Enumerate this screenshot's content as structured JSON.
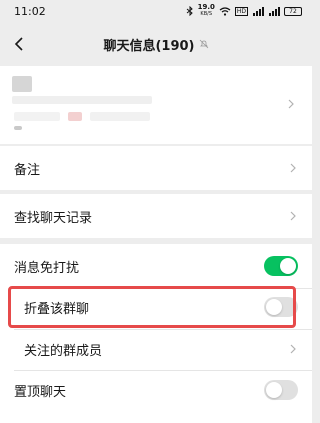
{
  "status_bar": {
    "time": "11:02",
    "speed": "19.0",
    "speed_unit": "KB/S",
    "battery": "72",
    "icons": [
      "bluetooth-icon",
      "wifi-icon",
      "hd-icon",
      "signal-icon",
      "signal-icon",
      "battery-icon"
    ]
  },
  "nav": {
    "title": "聊天信息(190)",
    "mute_icon": "bell-off-icon"
  },
  "rows": {
    "remark": "备注",
    "search_history": "查找聊天记录",
    "mute": "消息免打扰",
    "fold_group": "折叠该群聊",
    "followed_members": "关注的群成员",
    "pin_chat": "置顶聊天"
  },
  "toggles": {
    "mute": true,
    "fold_group": false,
    "pin_chat": false
  },
  "colors": {
    "toggle_on": "#07c160",
    "highlight": "#e64a4a"
  }
}
